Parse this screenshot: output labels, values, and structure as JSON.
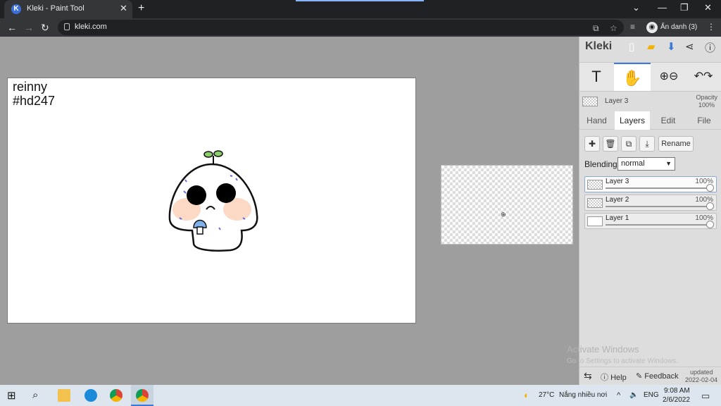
{
  "browser": {
    "tab_title": "Kleki - Paint Tool",
    "url": "kleki.com",
    "profile_label": "Ẩn danh (3)"
  },
  "canvas": {
    "text_line1": "reinny",
    "text_line2": "#hd247"
  },
  "panel": {
    "logo": "Kleki",
    "current_layer": "Layer 3",
    "opacity_label": "Opacity",
    "opacity_value": "100%",
    "tabs": [
      "Hand",
      "Layers",
      "Edit",
      "File"
    ],
    "active_tab": "Layers",
    "rename_label": "Rename",
    "blending_label": "Blending",
    "blending_value": "normal",
    "layers": [
      {
        "name": "Layer 3",
        "opacity": "100%",
        "selected": true
      },
      {
        "name": "Layer 2",
        "opacity": "100%",
        "selected": false
      },
      {
        "name": "Layer 1",
        "opacity": "100%",
        "selected": false
      }
    ],
    "help_label": "Help",
    "feedback_label": "Feedback",
    "updated_label": "updated",
    "updated_date": "2022-02-04",
    "watermark_title": "Activate Windows",
    "watermark_sub": "Go to Settings to activate Windows."
  },
  "taskbar": {
    "weather_temp": "27°C",
    "weather_desc": "Nắng nhiều nơi",
    "language": "ENG",
    "time": "9:08 AM",
    "date": "2/6/2022"
  },
  "colors": {
    "accent": "#3b78d8",
    "workspace": "#9e9e9e",
    "panel": "#dddddd"
  }
}
